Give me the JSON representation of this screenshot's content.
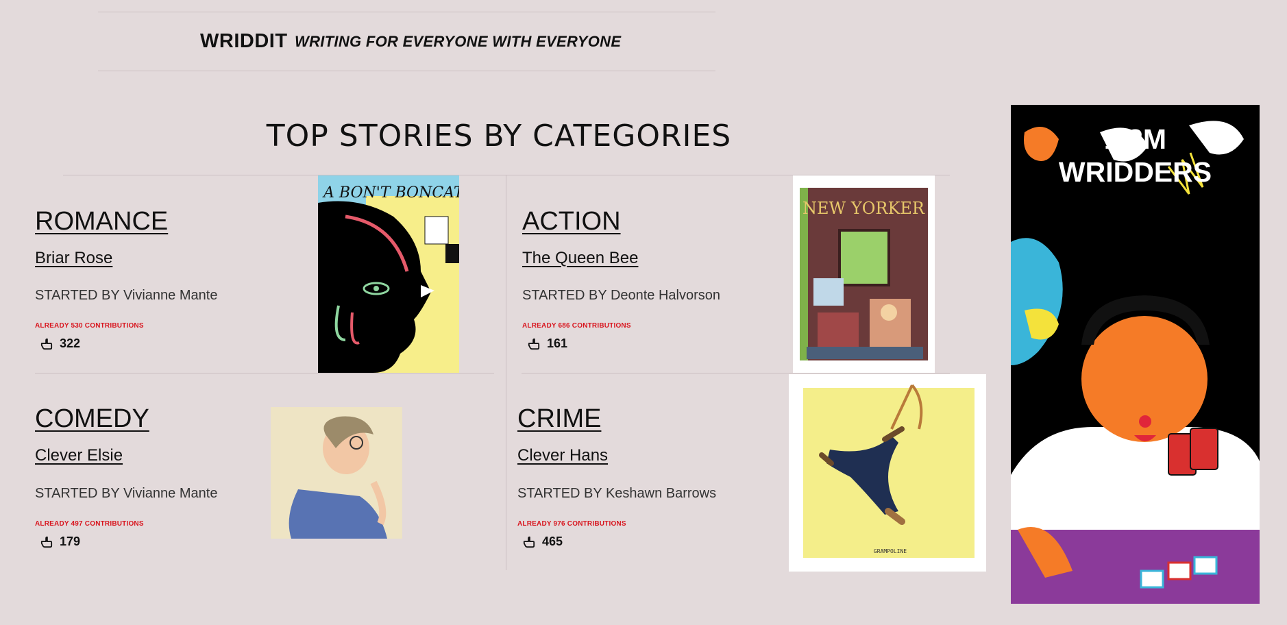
{
  "header": {
    "brand": "WRIDDIT",
    "tagline": "WRITING FOR EVERYONE WITH EVERYONE"
  },
  "section_title": "TOP STORIES BY CATEGORIES",
  "stories": [
    {
      "category": "ROMANCE",
      "title": "Briar Rose",
      "started_prefix": "STARTED BY",
      "author": "Vivianne Mante",
      "contributions": "ALREADY 530 CONTRIBUTIONS",
      "likes": "322",
      "cover_alt": "A BON'T BONCATA"
    },
    {
      "category": "ACTION",
      "title": "The Queen Bee",
      "started_prefix": "STARTED BY",
      "author": "Deonte Halvorson",
      "contributions": "ALREADY 686 CONTRIBUTIONS",
      "likes": "161",
      "cover_alt": "THE NEW YORKER"
    },
    {
      "category": "COMEDY",
      "title": "Clever Elsie",
      "started_prefix": "STARTED BY",
      "author": "Vivianne Mante",
      "contributions": "ALREADY 497 CONTRIBUTIONS",
      "likes": "179"
    },
    {
      "category": "CRIME",
      "title": "Clever Hans",
      "started_prefix": "STARTED BY",
      "author": "Keshawn Barrows",
      "contributions": "ALREADY 976 CONTRIBUTIONS",
      "likes": "465",
      "cover_alt": "GRAMPOLINE"
    }
  ],
  "banner": {
    "line1": "1.2M",
    "line2": "WRIDDERS"
  },
  "colors": {
    "background": "#e3dadb",
    "contribution_red": "#d8151e",
    "text": "#111111"
  },
  "icons": {
    "like": "hand-point-icon"
  }
}
